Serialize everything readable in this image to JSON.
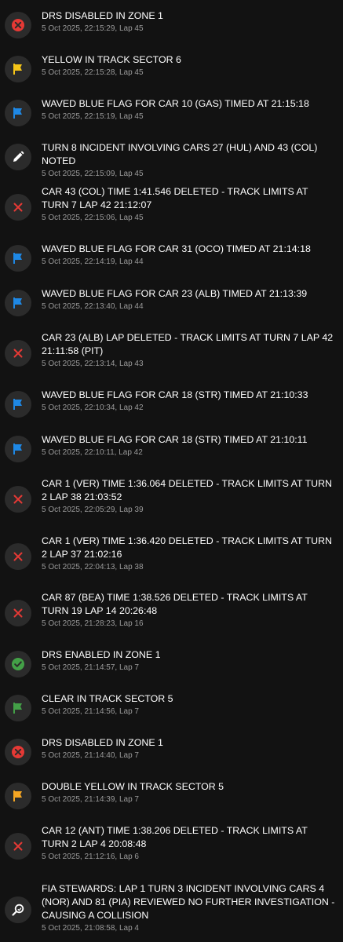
{
  "colors": {
    "background": "#121212",
    "badge": "#2b2b2b",
    "red": "#e53935",
    "yellow": "#f5c518",
    "blue": "#1e88e5",
    "green": "#43a047",
    "orange": "#f5a623",
    "text": "#ffffff",
    "meta": "#9a9a9a"
  },
  "messages": [
    {
      "icon": "red-x-circle-icon",
      "text": "DRS DISABLED IN ZONE 1",
      "meta": "5 Oct 2025, 22:15:29, Lap 45"
    },
    {
      "icon": "yellow-flag-icon",
      "text": "YELLOW IN TRACK SECTOR 6",
      "meta": "5 Oct 2025, 22:15:28, Lap 45"
    },
    {
      "icon": "blue-flag-icon",
      "text": "WAVED BLUE FLAG FOR CAR 10 (GAS) TIMED AT 21:15:18",
      "meta": "5 Oct 2025, 22:15:19, Lap 45"
    },
    {
      "icon": "pencil-icon",
      "text": "TURN 8 INCIDENT INVOLVING CARS 27 (HUL) AND 43 (COL) NOTED",
      "meta": "5 Oct 2025, 22:15:09, Lap 45"
    },
    {
      "icon": "red-x-icon",
      "text": "CAR 43 (COL) TIME 1:41.546 DELETED - TRACK LIMITS AT TURN 7 LAP 42 21:12:07",
      "meta": "5 Oct 2025, 22:15:06, Lap 45"
    },
    {
      "icon": "blue-flag-icon",
      "text": "WAVED BLUE FLAG FOR CAR 31 (OCO) TIMED AT 21:14:18",
      "meta": "5 Oct 2025, 22:14:19, Lap 44"
    },
    {
      "icon": "blue-flag-icon",
      "text": "WAVED BLUE FLAG FOR CAR 23 (ALB) TIMED AT 21:13:39",
      "meta": "5 Oct 2025, 22:13:40, Lap 44"
    },
    {
      "icon": "red-x-icon",
      "text": "CAR 23 (ALB) LAP DELETED - TRACK LIMITS AT TURN 7 LAP 42 21:11:58 (PIT)",
      "meta": "5 Oct 2025, 22:13:14, Lap 43"
    },
    {
      "icon": "blue-flag-icon",
      "text": "WAVED BLUE FLAG FOR CAR 18 (STR) TIMED AT 21:10:33",
      "meta": "5 Oct 2025, 22:10:34, Lap 42"
    },
    {
      "icon": "blue-flag-icon",
      "text": "WAVED BLUE FLAG FOR CAR 18 (STR) TIMED AT 21:10:11",
      "meta": "5 Oct 2025, 22:10:11, Lap 42"
    },
    {
      "icon": "red-x-icon",
      "text": "CAR 1 (VER) TIME 1:36.064 DELETED - TRACK LIMITS AT TURN 2 LAP 38 21:03:52",
      "meta": "5 Oct 2025, 22:05:29, Lap 39"
    },
    {
      "icon": "red-x-icon",
      "text": "CAR 1 (VER) TIME 1:36.420 DELETED - TRACK LIMITS AT TURN 2 LAP 37 21:02:16",
      "meta": "5 Oct 2025, 22:04:13, Lap 38"
    },
    {
      "icon": "red-x-icon",
      "text": "CAR 87 (BEA) TIME 1:38.526 DELETED - TRACK LIMITS AT TURN 19 LAP 14 20:26:48",
      "meta": "5 Oct 2025, 21:28:23, Lap 16"
    },
    {
      "icon": "green-check-circle-icon",
      "text": "DRS ENABLED IN ZONE 1",
      "meta": "5 Oct 2025, 21:14:57, Lap 7"
    },
    {
      "icon": "green-flag-icon",
      "text": "CLEAR IN TRACK SECTOR 5",
      "meta": "5 Oct 2025, 21:14:56, Lap 7"
    },
    {
      "icon": "red-x-circle-icon",
      "text": "DRS DISABLED IN ZONE 1",
      "meta": "5 Oct 2025, 21:14:40, Lap 7"
    },
    {
      "icon": "orange-flag-icon",
      "text": "DOUBLE YELLOW IN TRACK SECTOR 5",
      "meta": "5 Oct 2025, 21:14:39, Lap 7"
    },
    {
      "icon": "red-x-icon",
      "text": "CAR 12 (ANT) TIME 1:38.206 DELETED - TRACK LIMITS AT TURN 2 LAP 4 20:08:48",
      "meta": "5 Oct 2025, 21:12:16, Lap 6"
    },
    {
      "icon": "magnifier-icon",
      "text": "FIA STEWARDS: LAP 1 TURN 3 INCIDENT INVOLVING CARS 4 (NOR) AND 81 (PIA) REVIEWED NO FURTHER INVESTIGATION - CAUSING A COLLISION",
      "meta": "5 Oct 2025, 21:08:58, Lap 4"
    }
  ]
}
